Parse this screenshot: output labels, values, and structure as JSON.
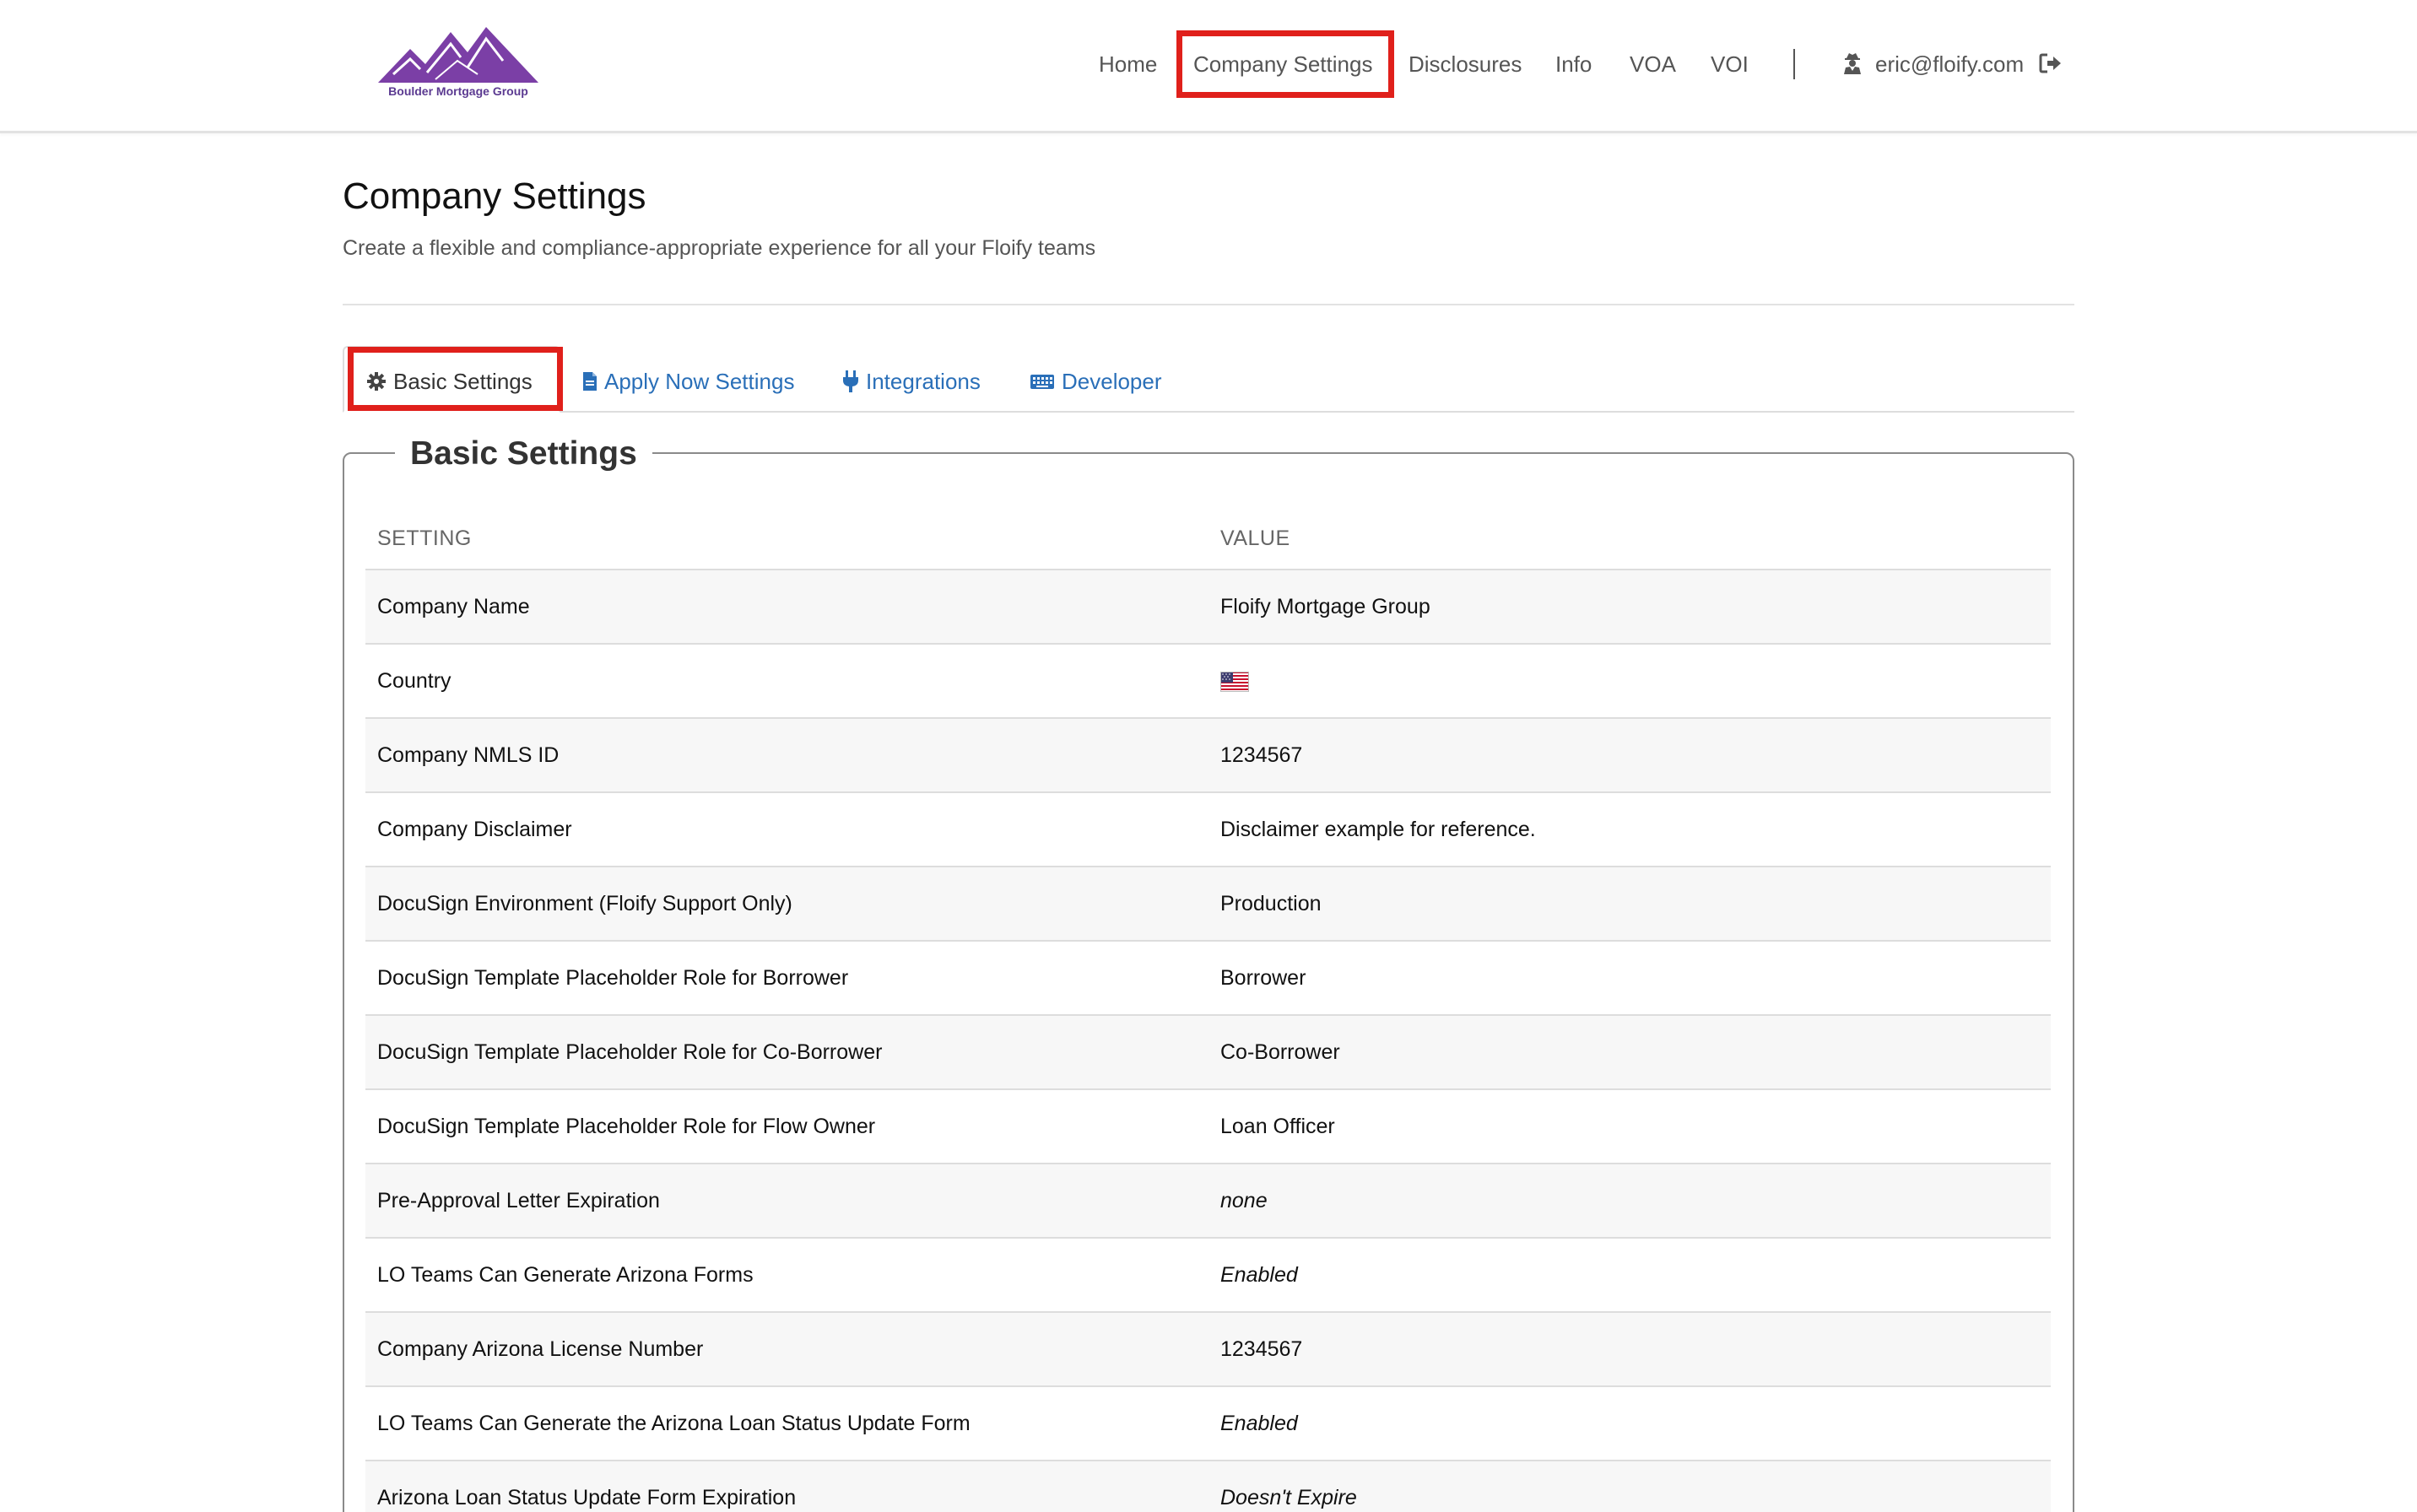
{
  "brand": {
    "logo_text": "Boulder Mortgage Group",
    "colors": {
      "logo": "#7b3fa6",
      "highlight": "#e0201b",
      "link": "#2a6fb8"
    }
  },
  "nav": {
    "items": [
      {
        "label": "Home"
      },
      {
        "label": "Company Settings",
        "active": true
      },
      {
        "label": "Disclosures"
      },
      {
        "label": "Info"
      },
      {
        "label": "VOA"
      },
      {
        "label": "VOI"
      }
    ],
    "user_email": "eric@floify.com",
    "user_icon": "user-secret-icon",
    "logout_icon": "sign-out-icon"
  },
  "header": {
    "title": "Company Settings",
    "subtitle": "Create a flexible and compliance-appropriate experience for all your Floify teams"
  },
  "tabs": [
    {
      "label": "Basic Settings",
      "icon": "gear-icon",
      "active": true
    },
    {
      "label": "Apply Now Settings",
      "icon": "file-icon"
    },
    {
      "label": "Integrations",
      "icon": "plug-icon"
    },
    {
      "label": "Developer",
      "icon": "keyboard-icon"
    }
  ],
  "panel": {
    "legend": "Basic Settings",
    "columns": [
      "SETTING",
      "VALUE"
    ],
    "rows": [
      {
        "setting": "Company Name",
        "value": "Floify Mortgage Group"
      },
      {
        "setting": "Country",
        "value": "",
        "flag": "us-flag-icon"
      },
      {
        "setting": "Company NMLS ID",
        "value": "1234567"
      },
      {
        "setting": "Company Disclaimer",
        "value": "Disclaimer example for reference."
      },
      {
        "setting": "DocuSign Environment (Floify Support Only)",
        "value": "Production"
      },
      {
        "setting": "DocuSign Template Placeholder Role for Borrower",
        "value": "Borrower"
      },
      {
        "setting": "DocuSign Template Placeholder Role for Co-Borrower",
        "value": "Co-Borrower"
      },
      {
        "setting": "DocuSign Template Placeholder Role for Flow Owner",
        "value": "Loan Officer"
      },
      {
        "setting": "Pre-Approval Letter Expiration",
        "value": "none",
        "italic": true
      },
      {
        "setting": "LO Teams Can Generate Arizona Forms",
        "value": "Enabled",
        "italic": true
      },
      {
        "setting": "Company Arizona License Number",
        "value": "1234567"
      },
      {
        "setting": "LO Teams Can Generate the Arizona Loan Status Update Form",
        "value": "Enabled",
        "italic": true
      },
      {
        "setting": "Arizona Loan Status Update Form Expiration",
        "value": "Doesn't Expire",
        "italic": true
      }
    ]
  }
}
